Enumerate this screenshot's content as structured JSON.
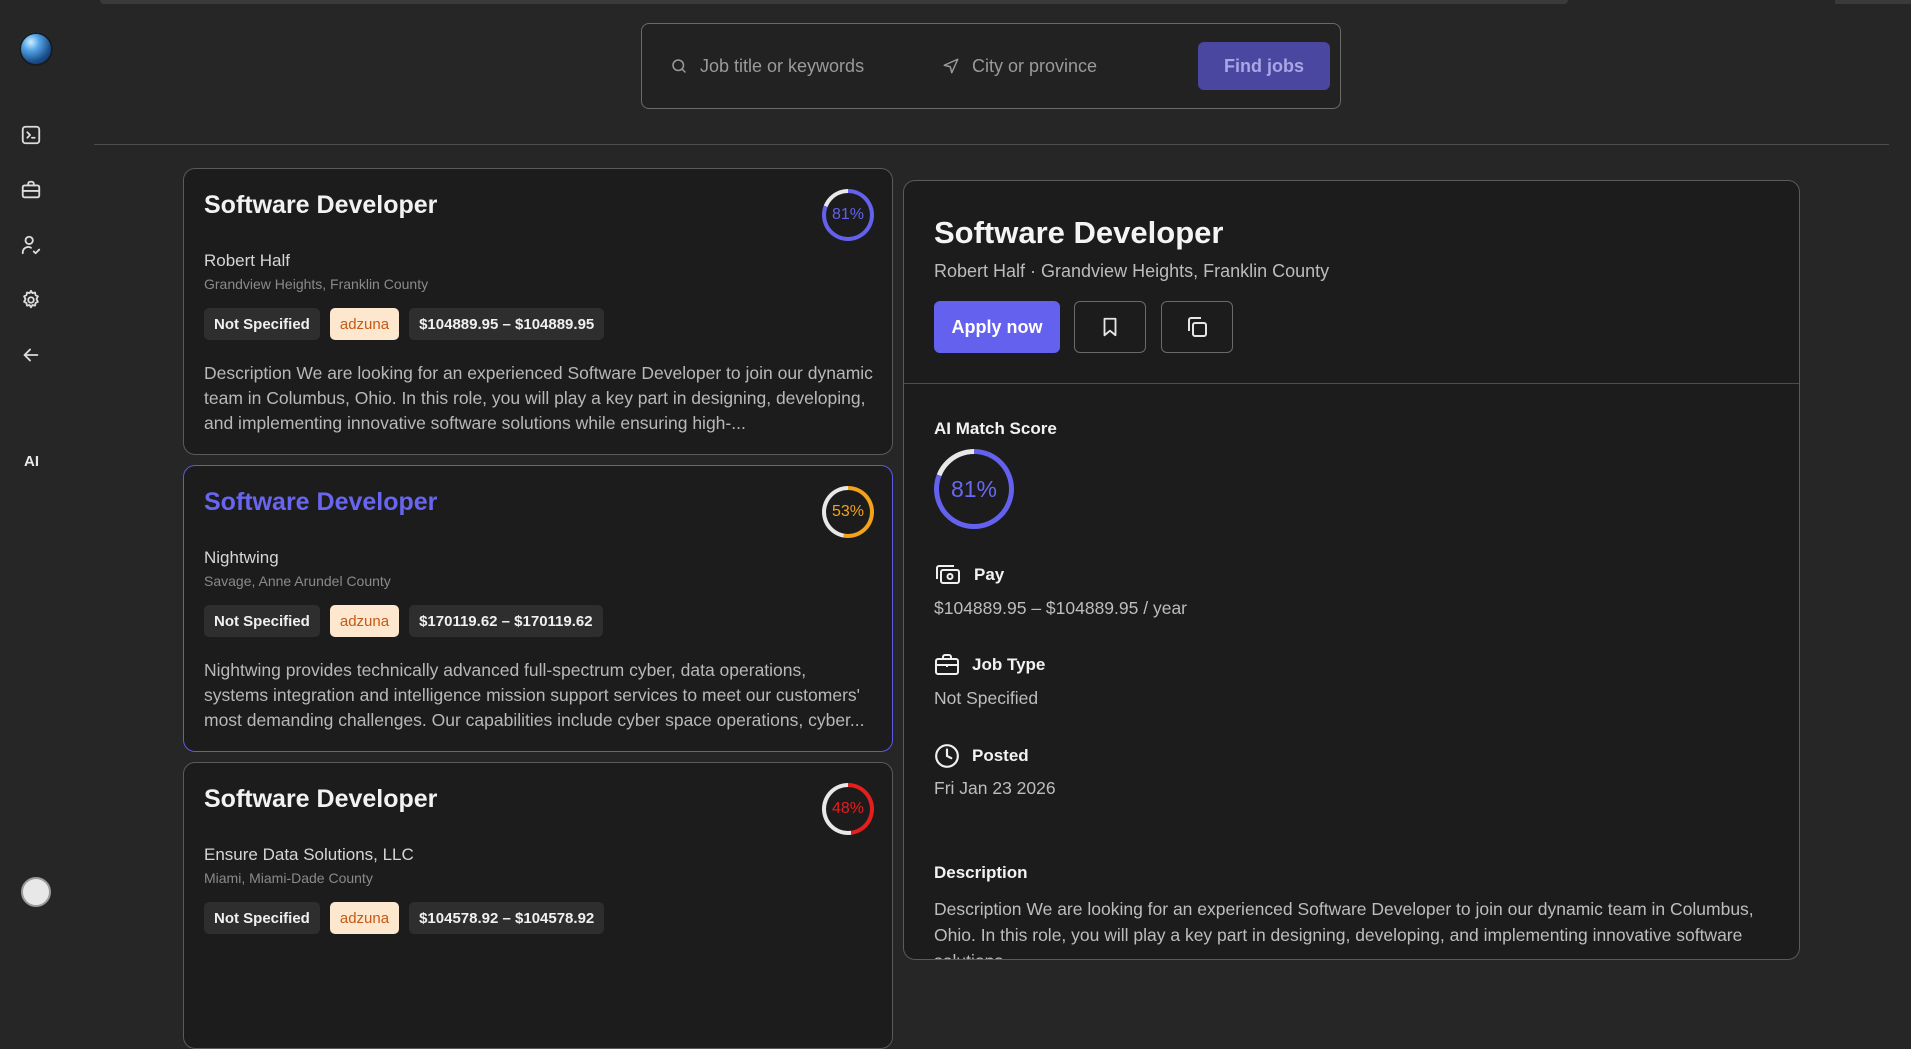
{
  "sidebar": {
    "items": [
      {
        "icon": "terminal-icon"
      },
      {
        "icon": "briefcase-icon"
      },
      {
        "icon": "user-check-icon"
      },
      {
        "icon": "gear-icon"
      },
      {
        "icon": "arrow-left-icon"
      }
    ],
    "ai_label": "AI"
  },
  "search": {
    "keywords_placeholder": "Job title or keywords",
    "location_placeholder": "City or province",
    "find_label": "Find jobs"
  },
  "jobs": [
    {
      "title": "Software Developer",
      "score": "81%",
      "score_value": 81,
      "score_color": "#6361ee",
      "company": "Robert Half",
      "location": "Grandview Heights, Franklin County",
      "type": "Not Specified",
      "source": "adzuna",
      "salary": "$104889.95 – $104889.95",
      "description": "Description We are looking for an experienced Software Developer to join our dynamic team in Columbus, Ohio. In this role, you will play a key part in designing, developing, and implementing innovative software solutions while ensuring high-..."
    },
    {
      "title": "Software Developer",
      "score": "53%",
      "score_value": 53,
      "score_color": "#f3a21b",
      "company": "Nightwing",
      "location": "Savage, Anne Arundel County",
      "type": "Not Specified",
      "source": "adzuna",
      "salary": "$170119.62 – $170119.62",
      "description": "Nightwing provides technically advanced full-spectrum cyber, data operations, systems integration and intelligence mission support services to meet our customers' most demanding challenges. Our capabilities include cyber space operations, cyber..."
    },
    {
      "title": "Software Developer",
      "score": "48%",
      "score_value": 48,
      "score_color": "#e51e1e",
      "company": "Ensure Data Solutions, LLC",
      "location": "Miami, Miami-Dade County",
      "type": "Not Specified",
      "source": "adzuna",
      "salary": "$104578.92 – $104578.92",
      "description": ""
    }
  ],
  "detail": {
    "title": "Software Developer",
    "subtitle": "Robert Half · Grandview Heights, Franklin County",
    "apply_label": "Apply now",
    "match_label": "AI Match Score",
    "match_score": "81%",
    "match_value": 81,
    "pay_label": "Pay",
    "pay_value": "$104889.95 – $104889.95 / year",
    "job_type_label": "Job Type",
    "job_type_value": "Not Specified",
    "posted_label": "Posted",
    "posted_value": "Fri Jan 23 2026",
    "description_label": "Description",
    "description": "Description We are looking for an experienced Software Developer to join our dynamic team in Columbus, Ohio. In this role, you will play a key part in designing, developing, and implementing innovative software solutions"
  },
  "colors": {
    "accent": "#6461ee",
    "background": "#262626",
    "card": "#1c1c1c"
  }
}
